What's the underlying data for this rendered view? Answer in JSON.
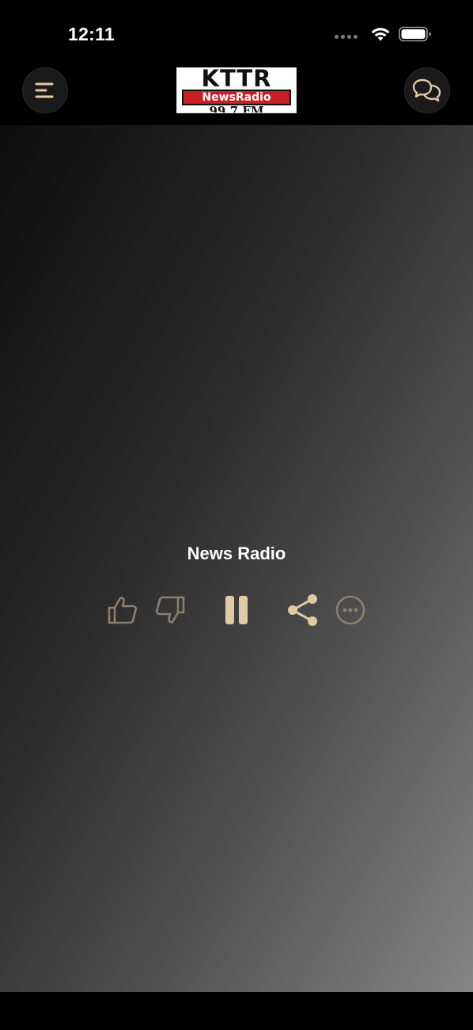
{
  "status_bar": {
    "time": "12:11"
  },
  "header": {
    "logo": {
      "call_letters": "KTTR",
      "tagline": "NewsRadio",
      "frequency": "99.7 FM"
    },
    "menu_icon": "menu-icon",
    "chat_icon": "chat-bubbles-icon"
  },
  "player": {
    "title": "News Radio",
    "controls": {
      "thumb_up_icon": "thumb-up-icon",
      "thumb_down_icon": "thumb-down-icon",
      "pause_icon": "pause-icon",
      "share_icon": "share-icon",
      "more_icon": "more-icon"
    }
  },
  "colors": {
    "accent": "#e2c9a6",
    "accent_dim": "#8c7f6f",
    "logo_red": "#c81e24"
  }
}
